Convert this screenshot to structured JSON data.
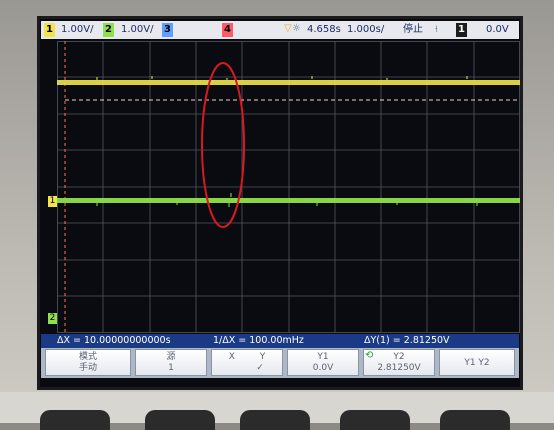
{
  "status_bar": {
    "ch1_num": "1",
    "ch1_scale": "1.00V/",
    "ch2_num": "2",
    "ch2_scale": "1.00V/",
    "ch3_num": "3",
    "ch4_num": "4",
    "trigger_delay": "4.658s",
    "time_scale": "1.000s/",
    "run_state": "停止",
    "trig_source_num": "1",
    "trig_level": "0.0V"
  },
  "markers": {
    "ch1": "1",
    "ch2": "2"
  },
  "measurements": {
    "delta_x": "ΔX = 10.00000000000s",
    "inv_delta_x": "1/ΔX = 100.00mHz",
    "delta_y": "ΔY(1) = 2.81250V"
  },
  "softkeys": {
    "mode_label": "模式",
    "mode_value": "手动",
    "source_label": "源",
    "source_value": "1",
    "xy_x": "X",
    "xy_y": "Y",
    "xy_check": "✓",
    "y1_label": "Y1",
    "y1_value": "0.0V",
    "y2_label": "Y2",
    "y2_value": "2.81250V",
    "y1y2_label": "Y1 Y2"
  },
  "colors": {
    "ch1": "#f2e44a",
    "ch2": "#8fe04a",
    "ch3": "#5fa0ff",
    "ch4": "#ff5a66",
    "annotation": "#d61a20"
  },
  "icons": {
    "brightness": "sun-icon",
    "trigger": "trigger-marker-icon",
    "cursor": "cursor-dashed-line"
  }
}
